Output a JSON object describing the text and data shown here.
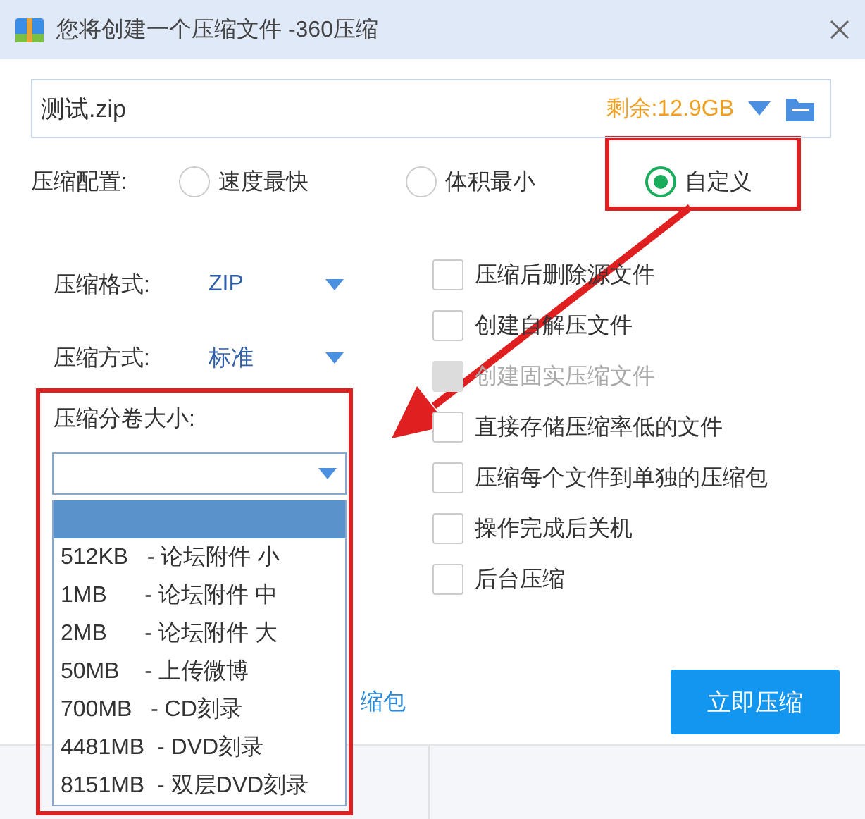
{
  "window": {
    "title": "您将创建一个压缩文件 -360压缩"
  },
  "path_field": {
    "value": "测试.zip",
    "free_space": "剩余:12.9GB"
  },
  "profile": {
    "label": "压缩配置:",
    "options": [
      {
        "label": "速度最快",
        "selected": false
      },
      {
        "label": "体积最小",
        "selected": false
      },
      {
        "label": "自定义",
        "selected": true
      }
    ]
  },
  "format": {
    "label": "压缩格式:",
    "value": "ZIP"
  },
  "method": {
    "label": "压缩方式:",
    "value": "标准"
  },
  "split": {
    "label": "压缩分卷大小:",
    "options": [
      {
        "selected": true
      },
      {
        "label": "512KB   - 论坛附件 小",
        "selected": false
      },
      {
        "label": "1MB      - 论坛附件 中",
        "selected": false
      },
      {
        "label": "2MB      - 论坛附件 大",
        "selected": false
      },
      {
        "label": "50MB    - 上传微博",
        "selected": false
      },
      {
        "label": "700MB   - CD刻录",
        "selected": false
      },
      {
        "label": "4481MB  - DVD刻录",
        "selected": false
      },
      {
        "label": "8151MB  - 双层DVD刻录",
        "selected": false
      }
    ]
  },
  "options": [
    {
      "label": "压缩后删除源文件",
      "checked": false,
      "disabled": false
    },
    {
      "label": "创建自解压文件",
      "checked": false,
      "disabled": false
    },
    {
      "label": "创建固实压缩文件",
      "checked": false,
      "disabled": true
    },
    {
      "label": "直接存储压缩率低的文件",
      "checked": false,
      "disabled": false
    },
    {
      "label": "压缩每个文件到单独的压缩包",
      "checked": false,
      "disabled": false
    },
    {
      "label": "操作完成后关机",
      "checked": false,
      "disabled": false
    },
    {
      "label": "后台压缩",
      "checked": false,
      "disabled": false
    }
  ],
  "hidden_link": "缩包",
  "compress_button": "立即压缩"
}
